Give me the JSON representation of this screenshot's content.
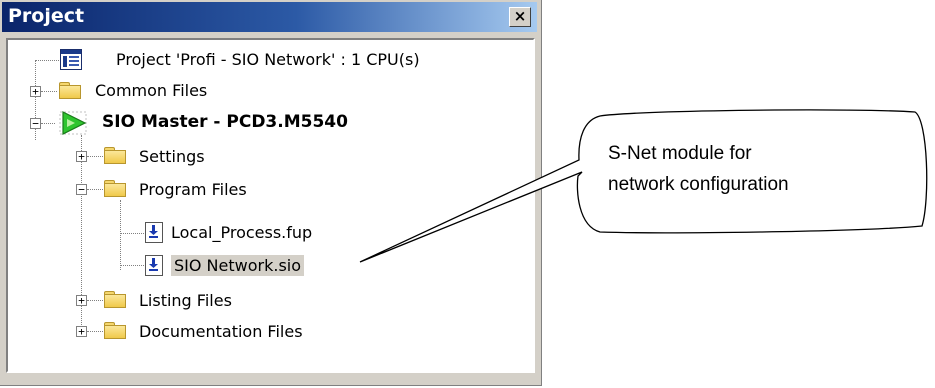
{
  "window": {
    "title": "Project",
    "close_label": "×"
  },
  "tree": {
    "project": "Project 'Profi - SIO Network' : 1 CPU(s)",
    "common_files": "Common Files",
    "cpu": "SIO Master - PCD3.M5540",
    "settings": "Settings",
    "program_files": "Program Files",
    "file_local": "Local_Process.fup",
    "file_sio": "SIO Network.sio",
    "listing_files": "Listing Files",
    "documentation_files": "Documentation Files"
  },
  "expanders": {
    "collapsed": "+",
    "expanded": "−"
  },
  "callout": {
    "line1": "S-Net module for",
    "line2": "network configuration"
  },
  "icons": [
    "project-icon",
    "folder-icon",
    "cpu-play-icon",
    "file-icon",
    "close-icon"
  ],
  "colors": {
    "titlebar": "#0a246a",
    "panel": "#d4d0c8",
    "folder": "#f7da6b",
    "cpu_arrow": "#2fc52f"
  }
}
